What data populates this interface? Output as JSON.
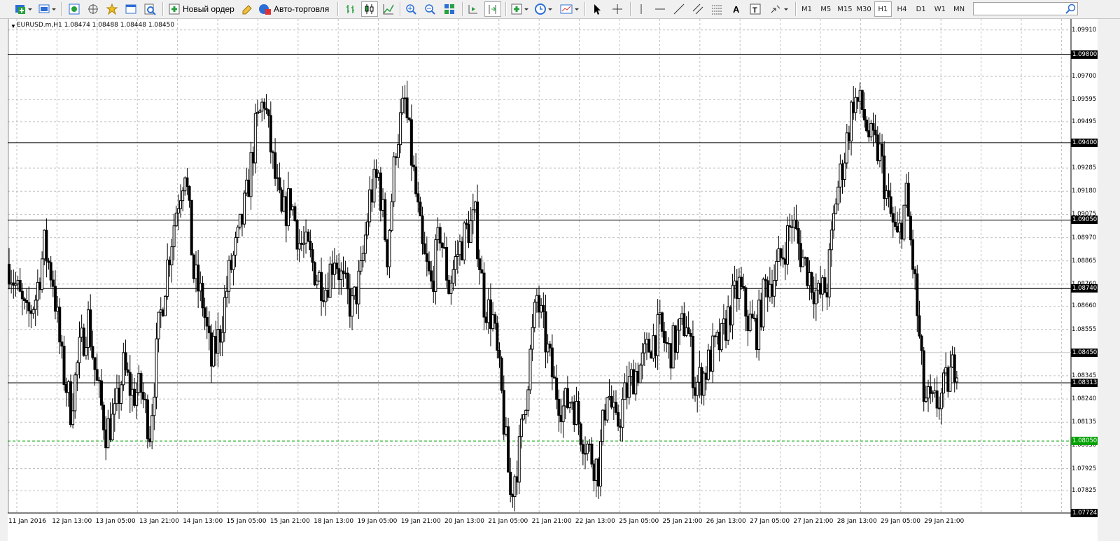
{
  "toolbar": {
    "new_order_label": "Новый ордер",
    "auto_trading_label": "Авто-торговля",
    "timeframes": [
      "M1",
      "M5",
      "M15",
      "M30",
      "H1",
      "H4",
      "D1",
      "W1",
      "MN"
    ],
    "active_timeframe": "H1",
    "search_placeholder": ""
  },
  "chart": {
    "info": "EURUSD.m,H1  1.08474 1.08488 1.08448 1.08450",
    "price_scale": [
      "1.09910",
      "1.09700",
      "1.09595",
      "1.09495",
      "1.09285",
      "1.09180",
      "1.09075",
      "1.08970",
      "1.08865",
      "1.08760",
      "1.08660",
      "1.08555",
      "1.08345",
      "1.08240",
      "1.08135",
      "1.08030",
      "1.07925",
      "1.07825"
    ],
    "level_labels": [
      "1.09800",
      "1.09400",
      "1.09050",
      "1.08740",
      "1.08450",
      "1.08313",
      "1.08050",
      "1.07724"
    ],
    "current_price": "1.08450",
    "pending_level": "1.08050",
    "time_labels": [
      "11 Jan 2016",
      "12 Jan 13:00",
      "13 Jan 05:00",
      "13 Jan 21:00",
      "14 Jan 13:00",
      "15 Jan 05:00",
      "15 Jan 21:00",
      "18 Jan 13:00",
      "19 Jan 05:00",
      "19 Jan 21:00",
      "20 Jan 13:00",
      "21 Jan 05:00",
      "21 Jan 21:00",
      "22 Jan 13:00",
      "25 Jan 05:00",
      "25 Jan 21:00",
      "26 Jan 13:00",
      "27 Jan 05:00",
      "27 Jan 21:00",
      "28 Jan 13:00",
      "29 Jan 05:00",
      "29 Jan 21:00"
    ],
    "colors": {
      "background": "#ffffff",
      "grid": "#c0c0c0",
      "bars": "#000000",
      "pending_line": "#00a000",
      "price_box": "#000000"
    }
  },
  "chart_data": {
    "type": "candlestick",
    "symbol": "EURUSD.m",
    "timeframe": "H1",
    "last": {
      "open": 1.08474,
      "high": 1.08488,
      "low": 1.08448,
      "close": 1.0845
    },
    "ylim": [
      1.07724,
      1.0996
    ],
    "horizontal_levels": [
      1.098,
      1.094,
      1.0905,
      1.0874,
      1.08313
    ],
    "pending_level": 1.0805,
    "series": [
      {
        "values": [
          1.0885,
          1.0872,
          1.086,
          1.087,
          1.0893,
          1.0878,
          1.084,
          1.082,
          1.0845,
          1.086,
          1.083,
          1.081,
          1.0815,
          1.0838,
          1.0826,
          1.0828,
          1.081,
          1.0855,
          1.0885,
          1.091,
          1.093,
          1.088,
          1.0868,
          1.084,
          1.0855,
          1.088,
          1.0895,
          1.0915,
          1.0945,
          1.096,
          1.093,
          1.0905,
          1.0915,
          1.0895,
          1.089,
          1.088,
          1.0875,
          1.089,
          1.0875,
          1.0865,
          1.088,
          1.0915,
          1.0925,
          1.089,
          1.094,
          1.0958,
          1.0925,
          1.089,
          1.0875,
          1.09,
          1.0875,
          1.089,
          1.09,
          1.0905,
          1.0868,
          1.086,
          1.0825,
          1.078,
          1.08,
          1.0835,
          1.087,
          1.085,
          1.083,
          1.082,
          1.0825,
          1.081,
          1.08,
          1.0792,
          1.083,
          1.081,
          1.0825,
          1.0835,
          1.084,
          1.085,
          1.0855,
          1.0845,
          1.0852,
          1.086,
          1.083,
          1.0835,
          1.0845,
          1.085,
          1.0865,
          1.0875,
          1.086,
          1.0855,
          1.0875,
          1.088,
          1.089,
          1.0905,
          1.089,
          1.088,
          1.087,
          1.0875,
          1.0915,
          1.0935,
          1.096,
          1.0955,
          1.094,
          1.0935,
          1.091,
          1.0895,
          1.0915,
          1.0875,
          1.0825,
          1.082,
          1.0825,
          1.0835,
          1.0845
        ]
      }
    ]
  }
}
